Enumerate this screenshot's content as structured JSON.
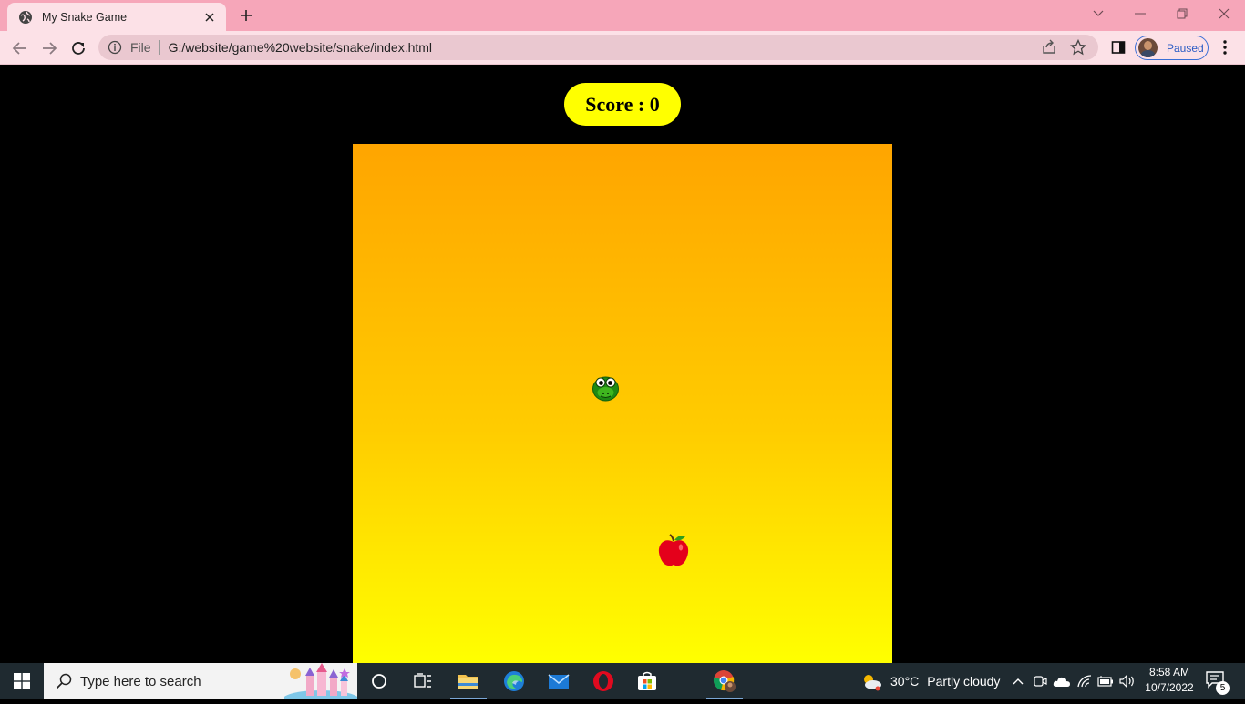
{
  "browser": {
    "tab_title": "My Snake Game",
    "address_scheme": "File",
    "address_url": "G:/website/game%20website/snake/index.html",
    "profile_label": "Paused",
    "accent_color": "#f6a6b9"
  },
  "game": {
    "score_text": "Score : 0",
    "score": 0,
    "board_gradient": [
      "#ffa500",
      "#ffff00"
    ],
    "score_bg": "#ffff00",
    "snake_icon": "snake-head-icon",
    "food_icon": "apple-icon"
  },
  "taskbar": {
    "search_placeholder": "Type here to search",
    "weather_temp": "30°C",
    "weather_condition": "Partly cloudy",
    "time": "8:58 AM",
    "date": "10/7/2022",
    "notification_count": "5"
  }
}
